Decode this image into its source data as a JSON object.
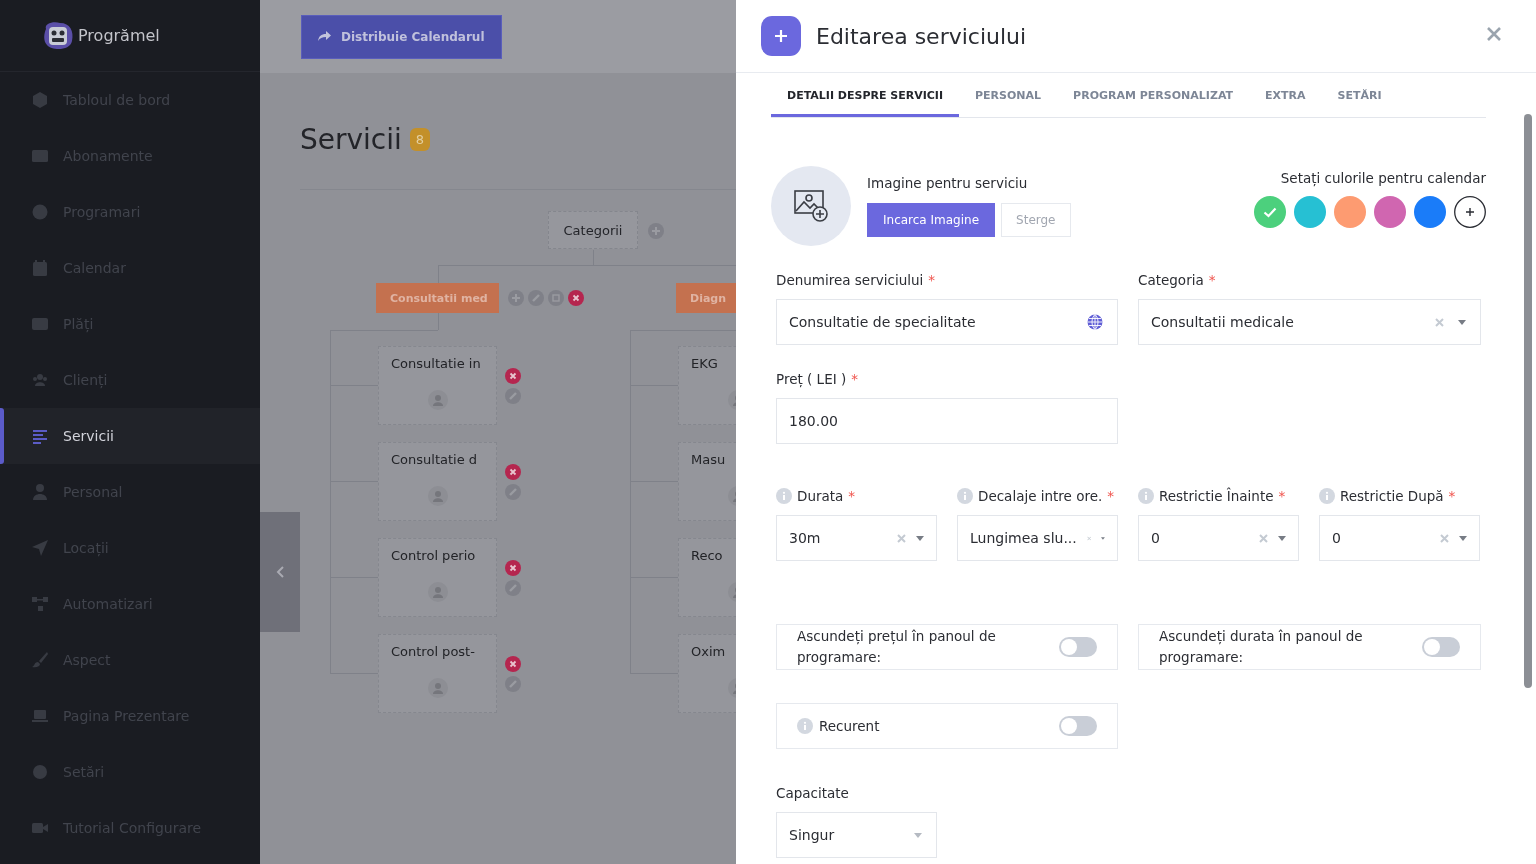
{
  "sidebar": {
    "brand": "Progrămel",
    "items": [
      {
        "label": "Tabloul de bord",
        "selected": false
      },
      {
        "label": "Abonamente",
        "selected": false
      },
      {
        "label": "Programari",
        "selected": false
      },
      {
        "label": "Calendar",
        "selected": false
      },
      {
        "label": "Plăți",
        "selected": false
      },
      {
        "label": "Clienți",
        "selected": false
      },
      {
        "label": "Servicii",
        "selected": true
      },
      {
        "label": "Personal",
        "selected": false
      },
      {
        "label": "Locații",
        "selected": false
      },
      {
        "label": "Automatizari",
        "selected": false
      },
      {
        "label": "Aspect",
        "selected": false
      },
      {
        "label": "Pagina Prezentare",
        "selected": false
      },
      {
        "label": "Setări",
        "selected": false
      },
      {
        "label": "Tutorial Configurare",
        "selected": false
      }
    ]
  },
  "topbar": {
    "share_button": "Distribuie Calendarul"
  },
  "page": {
    "title": "Servicii",
    "count": "8"
  },
  "tree": {
    "root": "Categorii",
    "categories": [
      {
        "name": "Consultatii med",
        "services": [
          "Consultatie in",
          "Consultatie d",
          "Control perio",
          "Control post-"
        ]
      },
      {
        "name": "Diagn",
        "services": [
          "EKG",
          "Masu",
          "Reco",
          "Oxim"
        ]
      }
    ]
  },
  "drawer": {
    "title": "Editarea serviciului",
    "tabs": [
      {
        "label": "DETALII DESPRE SERVICII",
        "selected": true
      },
      {
        "label": "PERSONAL",
        "selected": false
      },
      {
        "label": "PROGRAM PERSONALIZAT",
        "selected": false
      },
      {
        "label": "EXTRA",
        "selected": false
      },
      {
        "label": "SETĂRI",
        "selected": false
      }
    ],
    "image": {
      "label": "Imagine pentru serviciu",
      "upload_button": "Incarca Imagine",
      "delete_button": "Sterge"
    },
    "colors": {
      "label": "Setați culorile pentru calendar",
      "swatches": [
        {
          "color": "#4cd07d",
          "selected": true
        },
        {
          "color": "#26c0d3",
          "selected": false
        },
        {
          "color": "#fd9b71",
          "selected": false
        },
        {
          "color": "#d066b0",
          "selected": false
        },
        {
          "color": "#1a7cf9",
          "selected": false
        }
      ]
    },
    "name_field": {
      "label": "Denumirea serviciului",
      "required_mark": "*",
      "value": "Consultatie de specialitate"
    },
    "category_field": {
      "label": "Categoria",
      "required_mark": "*",
      "value": "Consultatii medicale"
    },
    "price_field": {
      "label": "Preț ( LEI )",
      "required_mark": "*",
      "value": "180.00"
    },
    "timing_fields": [
      {
        "label": "Durata",
        "required_mark": "*",
        "value": "30m"
      },
      {
        "label": "Decalaje intre ore.",
        "required_mark": "*",
        "value": "Lungimea slu..."
      },
      {
        "label": "Restrictie Înainte",
        "required_mark": "*",
        "value": "0"
      },
      {
        "label": "Restrictie După",
        "required_mark": "*",
        "value": "0"
      }
    ],
    "toggles": [
      {
        "label": "Ascundeți prețul în panoul de programare:",
        "on": false,
        "info": false
      },
      {
        "label": "Ascundeți durata în panoul de programare:",
        "on": false,
        "info": false
      },
      {
        "label": "Recurent",
        "on": false,
        "info": true
      }
    ],
    "capacity_field": {
      "label": "Capacitate",
      "value": "Singur"
    }
  }
}
